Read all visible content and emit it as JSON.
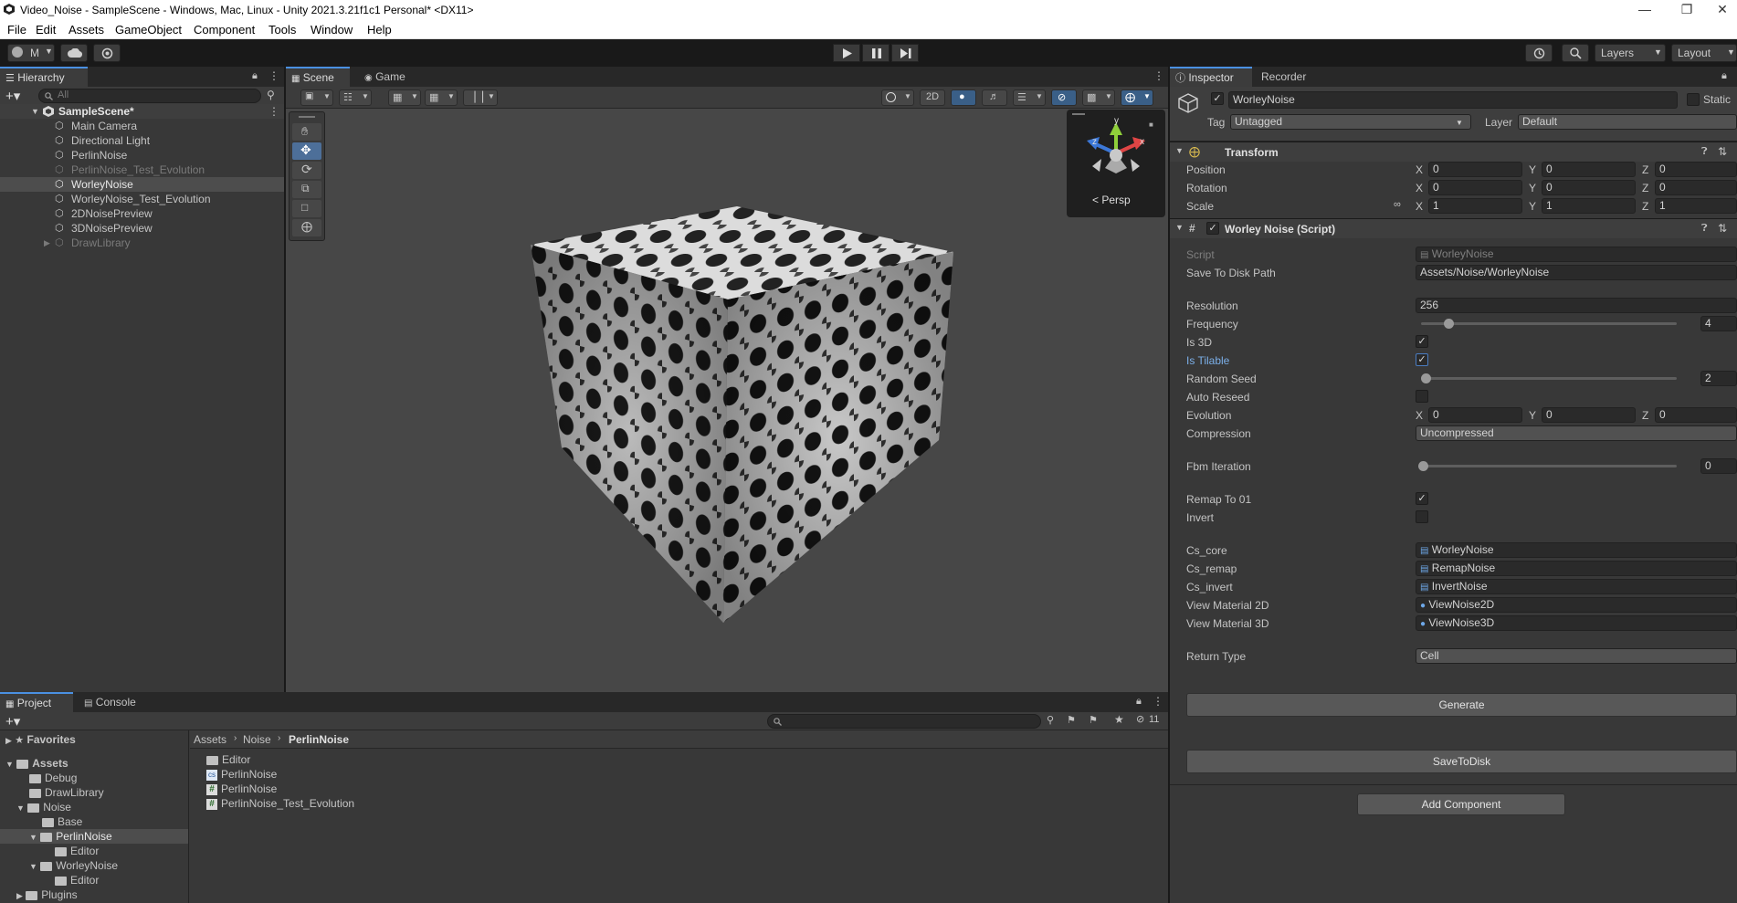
{
  "window": {
    "title": "Video_Noise - SampleScene - Windows, Mac, Linux - Unity 2021.3.21f1c1 Personal* <DX11>"
  },
  "menu": [
    "File",
    "Edit",
    "Assets",
    "GameObject",
    "Component",
    "Tools",
    "Window",
    "Help"
  ],
  "toolbar": {
    "account": "M",
    "layers": "Layers",
    "layout": "Layout"
  },
  "hierarchy": {
    "tab": "Hierarchy",
    "search_placeholder": "All",
    "scene_name": "SampleScene*",
    "items": [
      {
        "label": "Main Camera"
      },
      {
        "label": "Directional Light"
      },
      {
        "label": "PerlinNoise"
      },
      {
        "label": "PerlinNoise_Test_Evolution"
      },
      {
        "label": "WorleyNoise"
      },
      {
        "label": "WorleyNoise_Test_Evolution"
      },
      {
        "label": "2DNoisePreview"
      },
      {
        "label": "3DNoisePreview"
      },
      {
        "label": "DrawLibrary"
      }
    ]
  },
  "scene": {
    "tabs": [
      "Scene",
      "Game"
    ],
    "mode_2d": "2D",
    "gizmo_label": "Persp",
    "gizmo_axes": [
      "y",
      "z",
      "x"
    ]
  },
  "inspector": {
    "tabs": [
      "Inspector",
      "Recorder"
    ],
    "object_name": "WorleyNoise",
    "static_label": "Static",
    "tag_label": "Tag",
    "tag_value": "Untagged",
    "layer_label": "Layer",
    "layer_value": "Default",
    "transform": {
      "title": "Transform",
      "position_label": "Position",
      "rotation_label": "Rotation",
      "scale_label": "Scale",
      "position": [
        "0",
        "0",
        "0"
      ],
      "rotation": [
        "0",
        "0",
        "0"
      ],
      "scale": [
        "1",
        "1",
        "1"
      ],
      "axis_labels": [
        "X",
        "Y",
        "Z"
      ]
    },
    "script": {
      "title": "Worley Noise (Script)",
      "script_label": "Script",
      "script_value": "WorleyNoise",
      "save_path_label": "Save To Disk Path",
      "save_path_value": "Assets/Noise/WorleyNoise",
      "resolution_label": "Resolution",
      "resolution_value": "256",
      "frequency_label": "Frequency",
      "frequency_value": "4",
      "is3d_label": "Is 3D",
      "istilable_label": "Is Tilable",
      "random_seed_label": "Random Seed",
      "random_seed_value": "2",
      "auto_reseed_label": "Auto Reseed",
      "evolution_label": "Evolution",
      "evolution": [
        "0",
        "0",
        "0"
      ],
      "compression_label": "Compression",
      "compression_value": "Uncompressed",
      "fbm_label": "Fbm Iteration",
      "fbm_value": "0",
      "remap_label": "Remap To 01",
      "invert_label": "Invert",
      "cs_core_label": "Cs_core",
      "cs_core_value": "WorleyNoise",
      "cs_remap_label": "Cs_remap",
      "cs_remap_value": "RemapNoise",
      "cs_invert_label": "Cs_invert",
      "cs_invert_value": "InvertNoise",
      "view2d_label": "View Material 2D",
      "view2d_value": "ViewNoise2D",
      "view3d_label": "View Material 3D",
      "view3d_value": "ViewNoise3D",
      "return_type_label": "Return Type",
      "return_type_value": "Cell",
      "generate_label": "Generate",
      "save_to_disk_label": "SaveToDisk"
    },
    "add_component_label": "Add Component"
  },
  "project": {
    "tabs": [
      "Project",
      "Console"
    ],
    "hidden_count": "11",
    "favorites": "Favorites",
    "tree": [
      {
        "label": "Assets"
      },
      {
        "label": "Debug"
      },
      {
        "label": "DrawLibrary"
      },
      {
        "label": "Noise"
      },
      {
        "label": "Base"
      },
      {
        "label": "PerlinNoise"
      },
      {
        "label": "Editor"
      },
      {
        "label": "WorleyNoise"
      },
      {
        "label": "Editor"
      },
      {
        "label": "Plugins"
      }
    ],
    "breadcrumb": [
      "Assets",
      "Noise",
      "PerlinNoise"
    ],
    "files": [
      {
        "label": "Editor",
        "icon": "folder-icon"
      },
      {
        "label": "PerlinNoise",
        "icon": "compute-shader-icon"
      },
      {
        "label": "PerlinNoise",
        "icon": "csharp-script-icon"
      },
      {
        "label": "PerlinNoise_Test_Evolution",
        "icon": "csharp-script-icon"
      }
    ]
  }
}
